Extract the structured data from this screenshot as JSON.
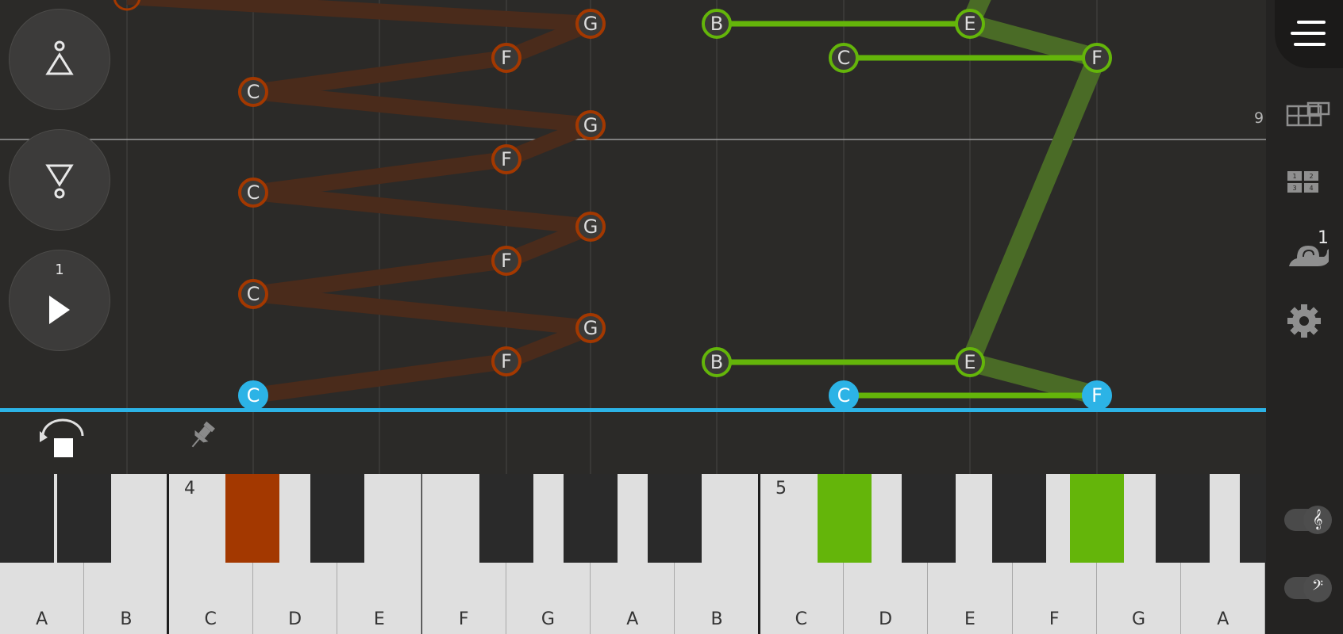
{
  "roll": {
    "left_hand_color": "#a33800",
    "right_hand_color": "#64b50a",
    "active_color": "#2cb3e6",
    "hand_line_color": "#4a2b1b",
    "notes_left": [
      "G",
      "F",
      "C",
      "G",
      "F",
      "C",
      "G",
      "F",
      "C",
      "G",
      "F",
      "C"
    ],
    "notes_right": [
      "B",
      "E",
      "C",
      "F",
      "B",
      "E",
      "C",
      "F"
    ]
  },
  "controls": {
    "loop_up_icon": "loop-up-icon",
    "loop_down_icon": "loop-down-icon",
    "play_icon": "play-icon",
    "play_count": "1",
    "rewind_icon": "rewind-stop-icon",
    "pin_icon": "pin-icon"
  },
  "rail": {
    "menu_icon": "menu-icon",
    "measure_number": "9",
    "grid_icon": "grid-icon",
    "numbers_icon": "finger-numbers-icon",
    "numbers_digits": [
      "1",
      "2",
      "3",
      "4"
    ],
    "speed_icon": "snail-icon",
    "speed_value": "1",
    "settings_icon": "gear-icon",
    "treble_label": "𝄞",
    "bass_label": "𝄢"
  },
  "keyboard": {
    "white_keys": [
      "A",
      "B",
      "C",
      "D",
      "E",
      "F",
      "G",
      "A",
      "B",
      "C",
      "D",
      "E",
      "F",
      "G",
      "A"
    ],
    "octave_labels": [
      {
        "label": "4"
      },
      {
        "label": "5"
      }
    ],
    "highlight_left": "#a33800",
    "highlight_right": "#64b50a"
  }
}
